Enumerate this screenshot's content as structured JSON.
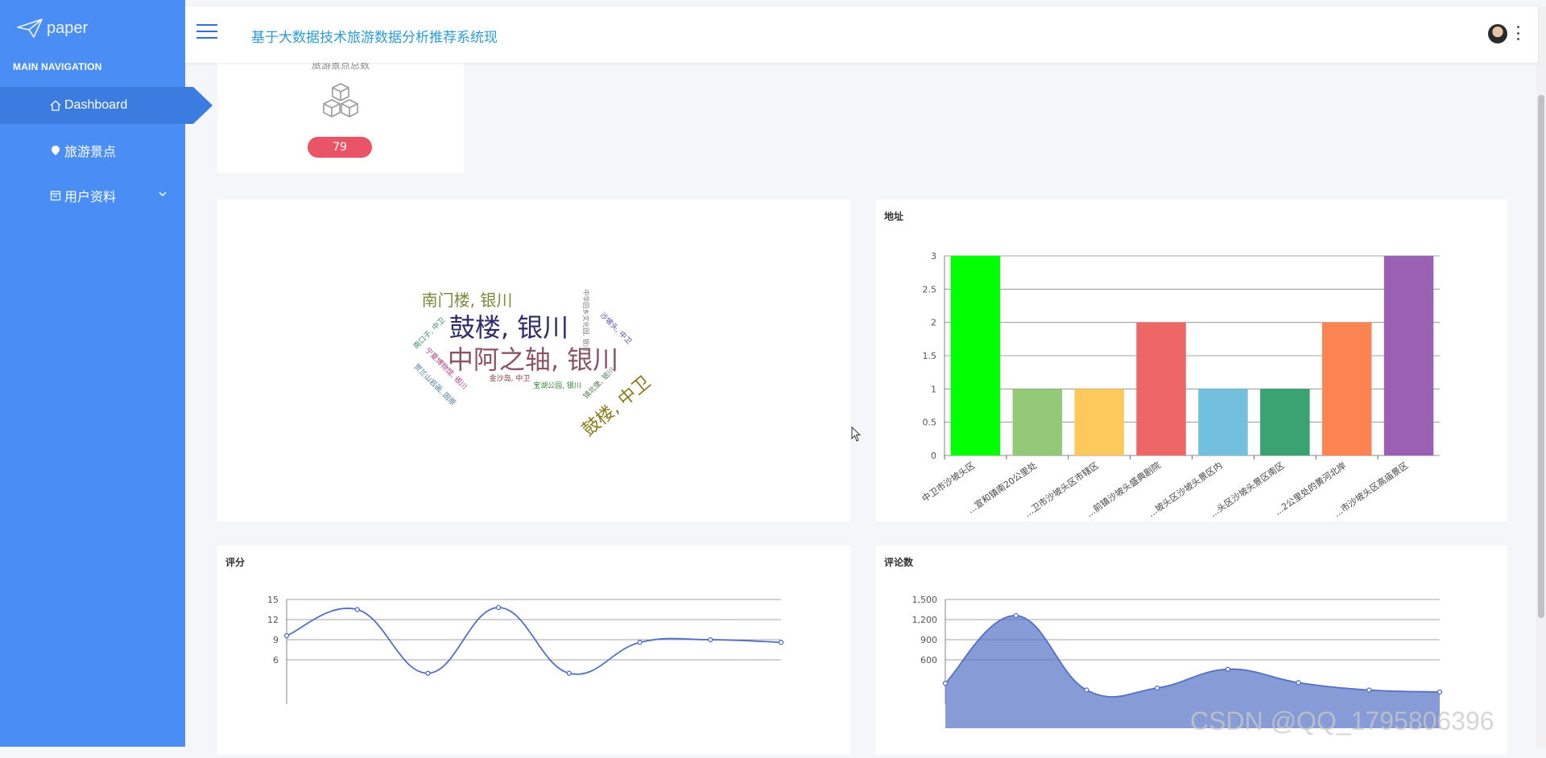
{
  "app": {
    "logo_text": "paper",
    "title": "基于大数据技术旅游数据分析推荐系统现"
  },
  "sidebar": {
    "heading": "MAIN NAVIGATION",
    "items": [
      {
        "label": "Dashboard",
        "icon": "home-icon",
        "active": true
      },
      {
        "label": "旅游景点",
        "icon": "location-dot-icon"
      },
      {
        "label": "用户资料",
        "icon": "calendar-icon",
        "expandable": true
      }
    ]
  },
  "stat": {
    "label": "旅游景点总数",
    "value": "79"
  },
  "wordcloud": {
    "words": [
      {
        "text": "南门楼, 银川",
        "color": "#7a8a3a"
      },
      {
        "text": "鼓楼, 银川",
        "color": "#2d2d6e"
      },
      {
        "text": "中阿之轴, 银川",
        "color": "#8a5566"
      },
      {
        "text": "鼓楼, 中卫",
        "color": "#8a7a1a"
      },
      {
        "text": "沙坡头, 中卫",
        "color": "#5a4a9a"
      },
      {
        "text": "中华回乡文化园, 银川",
        "color": "#777777"
      },
      {
        "text": "镇北堡, 银川",
        "color": "#5a7a5a"
      },
      {
        "text": "南口子, 中卫",
        "color": "#3a8a6a"
      },
      {
        "text": "宁夏博物馆, 银川",
        "color": "#aa4488"
      },
      {
        "text": "贺兰山岩画, 固原",
        "color": "#4a7a9a"
      },
      {
        "text": "金沙岛, 中卫",
        "color": "#8a3a3a"
      },
      {
        "text": "宝湖公园, 银川",
        "color": "#3a8a3a"
      }
    ]
  },
  "chart_data": [
    {
      "type": "bar",
      "title": "地址",
      "categories": [
        "中卫市沙坡头区",
        "...宣和镇南20公里处",
        "...卫市沙坡头区市辖区",
        "...前镇沙坡头盛典剧院",
        "...坡头区沙坡头景区内",
        "...头区沙坡头景区南区",
        "...2公里处的黄河北岸",
        "...市沙坡头区高庙景区"
      ],
      "values": [
        3,
        1,
        1,
        2,
        1,
        1,
        2,
        3
      ],
      "colors": [
        "#00ff00",
        "#93c977",
        "#fdc95d",
        "#ee6666",
        "#73c0de",
        "#3ba272",
        "#fc8452",
        "#9a60b4"
      ],
      "ylim": [
        0,
        3
      ],
      "yticks": [
        "0",
        "0.5",
        "1",
        "1.5",
        "2",
        "2.5",
        "3"
      ]
    },
    {
      "type": "line",
      "title": "评分",
      "values": [
        9.6,
        13.5,
        4,
        13.8,
        4,
        8.6,
        9,
        8.6
      ],
      "ylim": [
        3,
        15
      ],
      "yticks": [
        "6",
        "9",
        "12",
        "15"
      ],
      "smooth": true,
      "color": "#5470c6"
    },
    {
      "type": "area",
      "title": "评论数",
      "values": [
        250,
        1260,
        150,
        180,
        460,
        260,
        150,
        120
      ],
      "ylim": [
        300,
        1500
      ],
      "yticks": [
        "600",
        "900",
        "1,200",
        "1,500"
      ],
      "smooth": true,
      "color": "#5470c6"
    }
  ],
  "watermark": "CSDN @QQ_1795806396"
}
